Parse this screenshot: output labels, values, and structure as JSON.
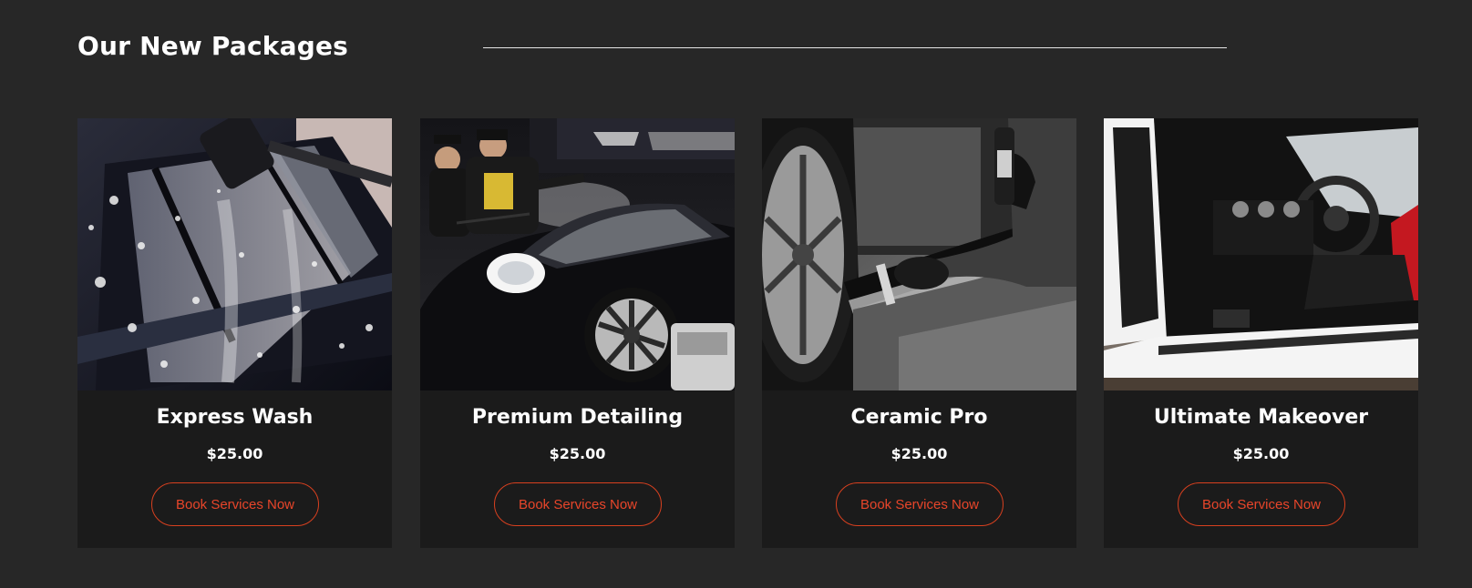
{
  "section": {
    "title": "Our New Packages"
  },
  "packages": [
    {
      "name": "Express Wash",
      "price": "$25.00",
      "button_label": "Book Services Now",
      "image": "car-foam-wash-photo"
    },
    {
      "name": "Premium Detailing",
      "price": "$25.00",
      "button_label": "Book Services Now",
      "image": "detailers-steam-porsche-photo"
    },
    {
      "name": "Ceramic Pro",
      "price": "$25.00",
      "button_label": "Book Services Now",
      "image": "ceramic-coating-application-photo"
    },
    {
      "name": "Ultimate Makeover",
      "price": "$25.00",
      "button_label": "Book Services Now",
      "image": "white-sportscar-interior-photo"
    }
  ],
  "colors": {
    "background": "#272727",
    "card": "#1b1b1b",
    "accent": "#e8452a",
    "text": "#ffffff"
  }
}
